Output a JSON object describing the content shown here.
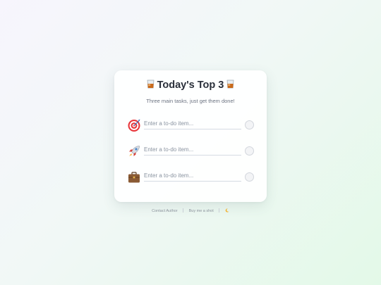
{
  "header": {
    "title": "Today's Top 3",
    "subtitle": "Three main tasks, just get them done!"
  },
  "tasks": [
    {
      "icon": "target-icon",
      "value": "",
      "placeholder": "Enter a to-do item...",
      "done": false
    },
    {
      "icon": "rocket-icon",
      "value": "",
      "placeholder": "Enter a to-do item...",
      "done": false
    },
    {
      "icon": "briefcase-icon",
      "value": "",
      "placeholder": "Enter a to-do item...",
      "done": false
    }
  ],
  "footer": {
    "contact_label": "Contact Author",
    "buy_label": "Buy me a shot",
    "theme_icon": "moon-icon"
  },
  "colors": {
    "title": "#2a2f3a",
    "subtitle": "#6b7280",
    "placeholder": "#8a93a0",
    "footer": "#8b929c"
  }
}
